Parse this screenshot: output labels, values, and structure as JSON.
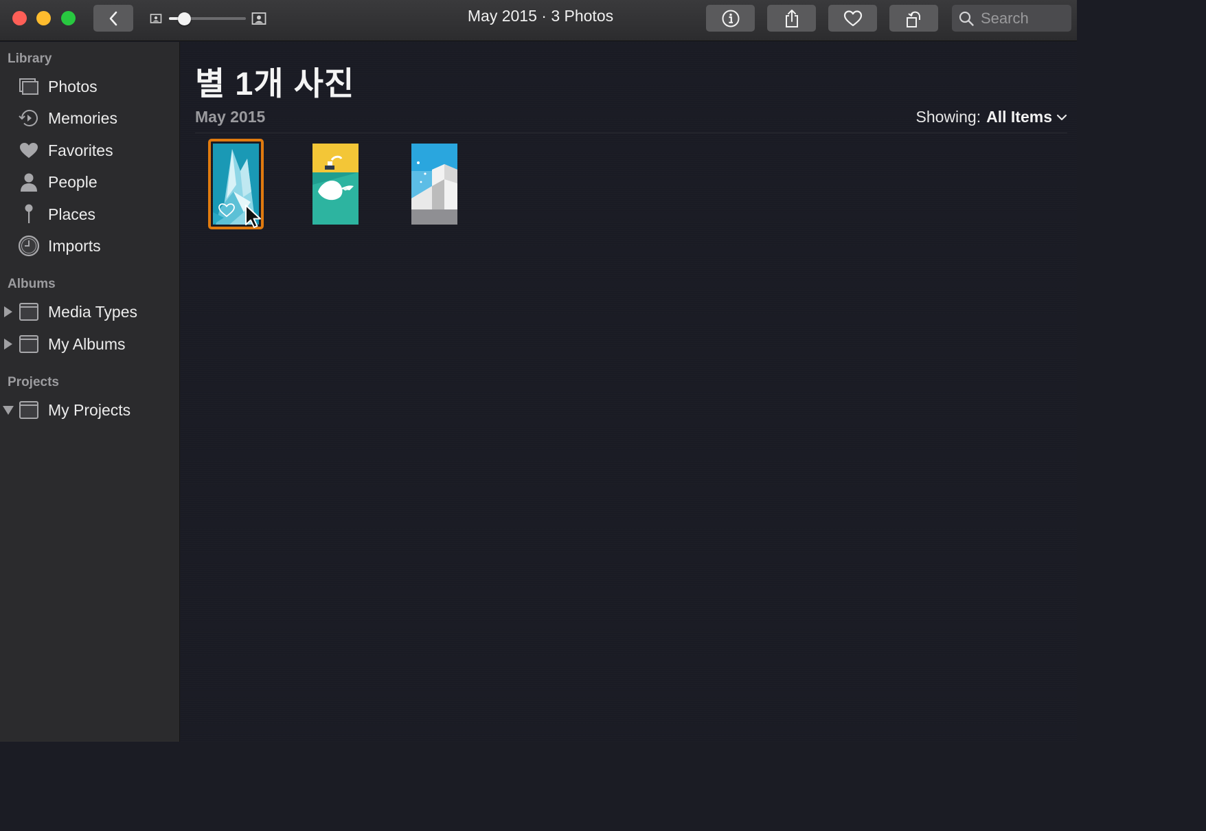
{
  "window": {
    "title": "May 2015 · 3 Photos"
  },
  "toolbar": {
    "back_icon": "chevron-left-icon",
    "zoom_slider_value": 0.2,
    "info_icon": "info-icon",
    "share_icon": "share-icon",
    "favorite_icon": "heart-icon",
    "rotate_icon": "rotate-icon",
    "search_placeholder": "Search"
  },
  "sidebar": {
    "library_title": "Library",
    "library_items": [
      {
        "label": "Photos",
        "icon": "photos-icon"
      },
      {
        "label": "Memories",
        "icon": "memories-icon"
      },
      {
        "label": "Favorites",
        "icon": "heart-icon"
      },
      {
        "label": "People",
        "icon": "person-icon"
      },
      {
        "label": "Places",
        "icon": "pin-icon"
      },
      {
        "label": "Imports",
        "icon": "clock-icon"
      }
    ],
    "albums_title": "Albums",
    "album_items": [
      {
        "label": "Media Types",
        "icon": "folder-icon",
        "expanded": false
      },
      {
        "label": "My Albums",
        "icon": "folder-icon",
        "expanded": false
      }
    ],
    "projects_title": "Projects",
    "project_items": [
      {
        "label": "My Projects",
        "icon": "folder-icon",
        "expanded": true
      }
    ]
  },
  "main": {
    "page_title": "별 1개 사진",
    "group_date": "May 2015",
    "showing_label": "Showing:",
    "showing_value": "All Items",
    "photos": [
      {
        "name": "iceberg",
        "selected": true,
        "favorite": true
      },
      {
        "name": "whale",
        "selected": false,
        "favorite": false
      },
      {
        "name": "steps",
        "selected": false,
        "favorite": false
      }
    ]
  },
  "colors": {
    "selection": "#e07a0f",
    "sidebar_bg": "#2b2b2d",
    "main_bg": "#1a1b24"
  }
}
